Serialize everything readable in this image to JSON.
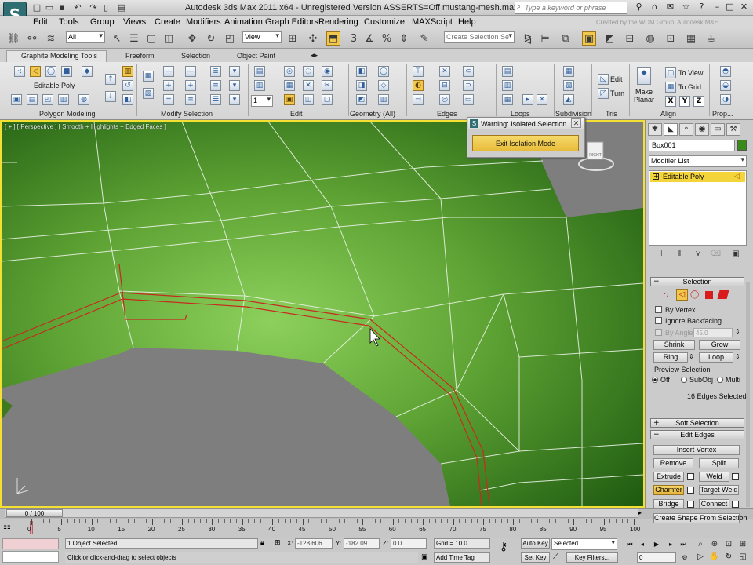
{
  "app": {
    "title": "Autodesk 3ds Max  2011 x64  - Unregistered Version ASSERTS=Off    mustang-mesh.max",
    "search_placeholder": "Type a keyword or phrase",
    "watermark": "Created by the WDM Group, Autodesk M&E",
    "logo_char": "S"
  },
  "menu": [
    "Edit",
    "Tools",
    "Group",
    "Views",
    "Create",
    "Modifiers",
    "Animation",
    "Graph Editors",
    "Rendering",
    "Customize",
    "MAXScript",
    "Help"
  ],
  "toolbar": {
    "filter_value": "All",
    "refcoord_value": "View",
    "spinner_snap": "3",
    "named_selection_placeholder": "Create Selection Se"
  },
  "ribbon": {
    "tabs": [
      "Graphite Modeling Tools",
      "Freeform",
      "Selection",
      "Object Paint"
    ],
    "active_object": "Editable Poly",
    "panels": [
      "Polygon Modeling",
      "Modify Selection",
      "Edit",
      "Geometry (All)",
      "Edges",
      "Loops",
      "Subdivision",
      "Tris",
      "Align",
      "Prop..."
    ],
    "number_field": "1",
    "edit_label": "Edit",
    "turn_label": "Turn",
    "make_planar": "Make Planar",
    "to_view": "To View",
    "to_grid": "To Grid",
    "xyz": [
      "X",
      "Y",
      "Z"
    ]
  },
  "viewport": {
    "label": "[ + ] [ Perspective ] [ Smooth + Highlights + Edged Faces ]",
    "viewcube_face": "RIGHT",
    "mesh_color": "#4e8f2a",
    "edge_color": "#c62b1e"
  },
  "popup": {
    "title": "Warning: Isolated Selection",
    "button": "Exit Isolation Mode",
    "close": "✕"
  },
  "command_panel": {
    "object_name": "Box001",
    "modifier_list": "Modifier List",
    "stack_item": "Editable Poly",
    "selection": {
      "header": "Selection",
      "by_vertex": "By Vertex",
      "ignore_backfacing": "Ignore Backfacing",
      "by_angle": "By Angle:",
      "angle_value": "45.0",
      "shrink": "Shrink",
      "grow": "Grow",
      "ring": "Ring",
      "loop": "Loop",
      "preview": "Preview Selection",
      "preview_opts": [
        "Off",
        "SubObj",
        "Multi"
      ],
      "count": "16 Edges Selected"
    },
    "soft_selection": "Soft Selection",
    "edit_edges": {
      "header": "Edit Edges",
      "insert_vertex": "Insert Vertex",
      "remove": "Remove",
      "split": "Split",
      "extrude": "Extrude",
      "weld": "Weld",
      "chamfer": "Chamfer",
      "target_weld": "Target Weld",
      "bridge": "Bridge",
      "connect": "Connect",
      "create_shape": "Create Shape From Selection"
    }
  },
  "timeline": {
    "slider": "0 / 100",
    "ticks": [
      "0",
      "5",
      "10",
      "15",
      "20",
      "25",
      "30",
      "35",
      "40",
      "45",
      "50",
      "55",
      "60",
      "65",
      "70",
      "75",
      "80",
      "85",
      "90",
      "95",
      "100"
    ]
  },
  "status": {
    "selected": "1 Object Selected",
    "prompt": "Click or click-and-drag to select objects",
    "x_label": "X:",
    "x_value": "-128.606",
    "y_label": "Y:",
    "y_value": "-182.09",
    "z_label": "Z:",
    "z_value": "0.0",
    "grid": "Grid = 10.0",
    "add_time_tag": "Add Time Tag",
    "auto_key": "Auto Key",
    "set_key": "Set Key",
    "key_mode": "Selected",
    "key_filters": "Key Filters...",
    "frame": "0"
  }
}
